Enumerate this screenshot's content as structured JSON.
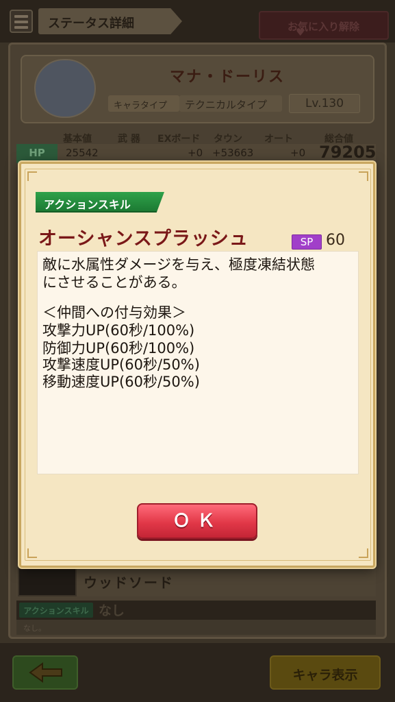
{
  "screen": {
    "title": "ステータス詳細",
    "favorite_button": "お気に入り解除",
    "character": {
      "name": "マナ・ドーリス",
      "type_label": "キャラタイプ",
      "type_value": "テクニカルタイプ",
      "level": "Lv.130"
    },
    "stat_headers": [
      "基本値",
      "武 器",
      "EXボード",
      "タウン",
      "オート",
      "総合値"
    ],
    "hp_row": {
      "label": "HP",
      "base": "25542",
      "ex_board": "+0",
      "town": "+53663",
      "auto": "+0",
      "total": "79205"
    },
    "weapon_name": "ウッドソード",
    "action_skill_label": "アクションスキル",
    "action_skill_value": "なし",
    "action_skill_desc": "なし。",
    "back_button_icon": "left-arrow-icon",
    "chara_button": "キャラ表示"
  },
  "modal": {
    "tag": "アクションスキル",
    "skill_name": "オーシャンスプラッシュ",
    "sp_label": "SP",
    "sp_value": "60",
    "description_lines": [
      "敵に水属性ダメージを与え、極度凍結状態",
      "にさせることがある。",
      "",
      "＜仲間への付与効果＞",
      "攻撃力UP(60秒/100%)",
      "防御力UP(60秒/100%)",
      "攻撃速度UP(60秒/50%)",
      "移動速度UP(60秒/50%)"
    ],
    "ok_button": "ＯＫ"
  },
  "colors": {
    "modal_bg": "#f5e6c2",
    "skill_name": "#7a1818",
    "tag_green": "#1c7a33",
    "sp_purple": "#a13fc9",
    "ok_red": "#e23848"
  }
}
